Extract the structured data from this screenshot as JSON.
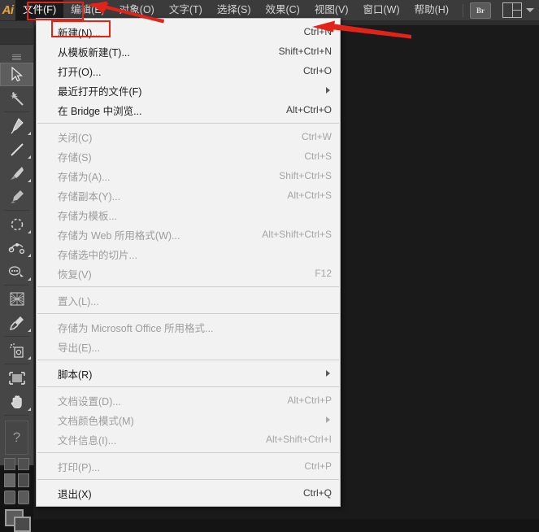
{
  "app": {
    "name": "Adobe Illustrator",
    "logo_text": "Ai"
  },
  "menubar": {
    "items": [
      {
        "label": "文件(F)",
        "name": "menu-file",
        "active": true
      },
      {
        "label": "编辑(E)",
        "name": "menu-edit",
        "active": false
      },
      {
        "label": "对象(O)",
        "name": "menu-object",
        "active": false
      },
      {
        "label": "文字(T)",
        "name": "menu-type",
        "active": false
      },
      {
        "label": "选择(S)",
        "name": "menu-select",
        "active": false
      },
      {
        "label": "效果(C)",
        "name": "menu-effect",
        "active": false
      },
      {
        "label": "视图(V)",
        "name": "menu-view",
        "active": false
      },
      {
        "label": "窗口(W)",
        "name": "menu-window",
        "active": false
      },
      {
        "label": "帮助(H)",
        "name": "menu-help",
        "active": false
      }
    ],
    "bridge_button_label": "Br",
    "workspace_switcher_icon": "workspace-grid-icon"
  },
  "file_menu": {
    "rows": [
      {
        "label": "新建(N)...",
        "accel": "Ctrl+N",
        "disabled": false,
        "submenu": false,
        "highlighted": true,
        "name": "menu-item-new"
      },
      {
        "label": "从模板新建(T)...",
        "accel": "Shift+Ctrl+N",
        "disabled": false,
        "submenu": false,
        "name": "menu-item-new-from-template"
      },
      {
        "label": "打开(O)...",
        "accel": "Ctrl+O",
        "disabled": false,
        "submenu": false,
        "name": "menu-item-open"
      },
      {
        "label": "最近打开的文件(F)",
        "accel": "",
        "disabled": false,
        "submenu": true,
        "name": "menu-item-open-recent"
      },
      {
        "label": "在 Bridge 中浏览...",
        "accel": "Alt+Ctrl+O",
        "disabled": false,
        "submenu": false,
        "name": "menu-item-browse-in-bridge"
      },
      {
        "separator": true
      },
      {
        "label": "关闭(C)",
        "accel": "Ctrl+W",
        "disabled": true,
        "submenu": false,
        "name": "menu-item-close"
      },
      {
        "label": "存储(S)",
        "accel": "Ctrl+S",
        "disabled": true,
        "submenu": false,
        "name": "menu-item-save"
      },
      {
        "label": "存储为(A)...",
        "accel": "Shift+Ctrl+S",
        "disabled": true,
        "submenu": false,
        "name": "menu-item-save-as"
      },
      {
        "label": "存储副本(Y)...",
        "accel": "Alt+Ctrl+S",
        "disabled": true,
        "submenu": false,
        "name": "menu-item-save-a-copy"
      },
      {
        "label": "存储为模板...",
        "accel": "",
        "disabled": true,
        "submenu": false,
        "name": "menu-item-save-as-template"
      },
      {
        "label": "存储为 Web 所用格式(W)...",
        "accel": "Alt+Shift+Ctrl+S",
        "disabled": true,
        "submenu": false,
        "name": "menu-item-save-for-web"
      },
      {
        "label": "存储选中的切片...",
        "accel": "",
        "disabled": true,
        "submenu": false,
        "name": "menu-item-save-selected-slices"
      },
      {
        "label": "恢复(V)",
        "accel": "F12",
        "disabled": true,
        "submenu": false,
        "name": "menu-item-revert"
      },
      {
        "separator": true
      },
      {
        "label": "置入(L)...",
        "accel": "",
        "disabled": true,
        "submenu": false,
        "name": "menu-item-place"
      },
      {
        "separator": true
      },
      {
        "label": "存储为 Microsoft Office 所用格式...",
        "accel": "",
        "disabled": true,
        "submenu": false,
        "name": "menu-item-save-for-office"
      },
      {
        "label": "导出(E)...",
        "accel": "",
        "disabled": true,
        "submenu": false,
        "name": "menu-item-export"
      },
      {
        "separator": true
      },
      {
        "label": "脚本(R)",
        "accel": "",
        "disabled": false,
        "submenu": true,
        "name": "menu-item-scripts"
      },
      {
        "separator": true
      },
      {
        "label": "文档设置(D)...",
        "accel": "Alt+Ctrl+P",
        "disabled": true,
        "submenu": false,
        "name": "menu-item-document-setup"
      },
      {
        "label": "文档颜色模式(M)",
        "accel": "",
        "disabled": true,
        "submenu": true,
        "name": "menu-item-document-color-mode"
      },
      {
        "label": "文件信息(I)...",
        "accel": "Alt+Shift+Ctrl+I",
        "disabled": true,
        "submenu": false,
        "name": "menu-item-file-info"
      },
      {
        "separator": true
      },
      {
        "label": "打印(P)...",
        "accel": "Ctrl+P",
        "disabled": true,
        "submenu": false,
        "name": "menu-item-print"
      },
      {
        "separator": true
      },
      {
        "label": "退出(X)",
        "accel": "Ctrl+Q",
        "disabled": false,
        "submenu": false,
        "name": "menu-item-exit"
      }
    ]
  },
  "toolbar": {
    "tools": [
      {
        "name": "selection-tool-icon",
        "selected": true,
        "flyout": false
      },
      {
        "name": "magic-wand-tool-icon",
        "selected": false,
        "flyout": false
      },
      {
        "name": "pen-tool-icon",
        "selected": false,
        "flyout": true
      },
      {
        "name": "line-segment-tool-icon",
        "selected": false,
        "flyout": true
      },
      {
        "name": "paintbrush-tool-icon",
        "selected": false,
        "flyout": true
      },
      {
        "name": "blob-brush-tool-icon",
        "selected": false,
        "flyout": false
      },
      {
        "name": "rotate-tool-icon",
        "selected": false,
        "flyout": true
      },
      {
        "name": "width-tool-icon",
        "selected": false,
        "flyout": true
      },
      {
        "name": "shape-builder-tool-icon",
        "selected": false,
        "flyout": true
      },
      {
        "name": "perspective-grid-tool-icon",
        "selected": false,
        "flyout": false
      },
      {
        "name": "eyedropper-tool-icon",
        "selected": false,
        "flyout": true
      },
      {
        "name": "symbol-sprayer-tool-icon",
        "selected": false,
        "flyout": true
      },
      {
        "name": "artboard-tool-icon",
        "selected": false,
        "flyout": false
      },
      {
        "name": "hand-tool-icon",
        "selected": false,
        "flyout": true
      }
    ],
    "question_mark_label": "?",
    "small_swatch_label": "?"
  },
  "annotations": {
    "highlight_color": "#e2231a",
    "arrow_color": "#e2231a",
    "highlights": [
      {
        "name": "highlight-file-menu",
        "target": "文件(F)"
      },
      {
        "name": "highlight-new-item",
        "target": "新建(N)..."
      }
    ],
    "arrows": [
      {
        "name": "arrow-pointing-to-file-menu",
        "direction": "left"
      },
      {
        "name": "arrow-pointing-to-ctrl-n",
        "direction": "left"
      }
    ]
  }
}
